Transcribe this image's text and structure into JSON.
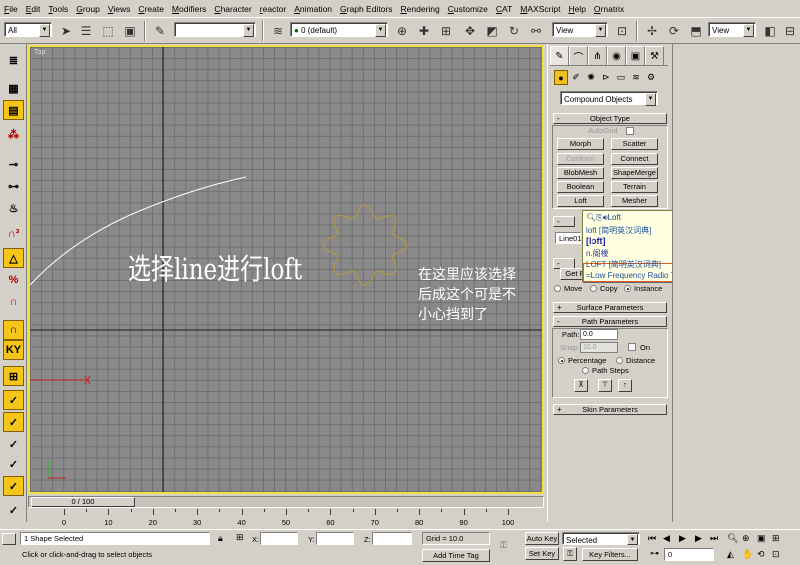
{
  "menu": [
    "File",
    "Edit",
    "Tools",
    "Group",
    "Views",
    "Create",
    "Modifiers",
    "Character",
    "reactor",
    "Animation",
    "Graph Editors",
    "Rendering",
    "Customize",
    "CAT",
    "MAXScript",
    "Help",
    "Ornatrix"
  ],
  "toolbar": {
    "selection_filter": "All",
    "named_selection": "",
    "layer": "0 (default)",
    "ref_coord": "View",
    "ref_coord_2": "View"
  },
  "viewport": {
    "label": "Top",
    "annotation_main": "选择line进行loft",
    "annotation_side": "在这里应该选择\n后成这个可是不\n小心挡到了"
  },
  "command_panel": {
    "category": "Compound Objects",
    "object_type": {
      "title": "Object Type",
      "autogrid_label": "AutoGrid",
      "buttons": [
        "Morph",
        "Scatter",
        "Conform",
        "Connect",
        "BlobMesh",
        "ShapeMerge",
        "Boolean",
        "Terrain",
        "Loft",
        "Mesher"
      ]
    },
    "name_field": "Line01",
    "get_btn": "Get P",
    "move_label": "Move",
    "copy_label": "Copy",
    "instance_label": "Instance",
    "surface_params": "Surface Parameters",
    "path_params": "Path Parameters",
    "path_label": "Path:",
    "path_value": "0.0",
    "snap_label": "Snap:",
    "snap_value": "10.0",
    "on_label": "On",
    "percentage_label": "Percentage",
    "distance_label": "Distance",
    "path_steps_label": "Path Steps",
    "skin_params": "Skin Parameters"
  },
  "dictionary_popup": {
    "headword": "Loft",
    "line1": "loft [简明英汉词典]",
    "line2": "[lɔft]",
    "line3": "n.阁楼",
    "line4": "LOFT [简明英汉词典]",
    "line5": "=Low Frequency Radio Telescope 低频射电望远镜",
    "ime": "中"
  },
  "timeline": {
    "slider_label": "0 / 100",
    "ticks": [
      "0",
      "10",
      "20",
      "30",
      "40",
      "50",
      "60",
      "70",
      "80",
      "90",
      "100"
    ]
  },
  "statusbar": {
    "selected": "1 Shape Selected",
    "prompt": "Click or click-and-drag to select objects",
    "x_label": "X:",
    "y_label": "Y:",
    "z_label": "Z:",
    "grid": "Grid = 10.0",
    "add_time_tag": "Add Time Tag",
    "auto_key": "Auto Key",
    "set_key": "Set Key",
    "key_mode": "Selected",
    "key_filters": "Key Filters...",
    "frame": "0"
  },
  "colors": {
    "viewport_bg": "#8a8a8a",
    "active_border": "#f0e040",
    "shape_star": "#b89a3a",
    "line_spline": "#ffffff"
  }
}
